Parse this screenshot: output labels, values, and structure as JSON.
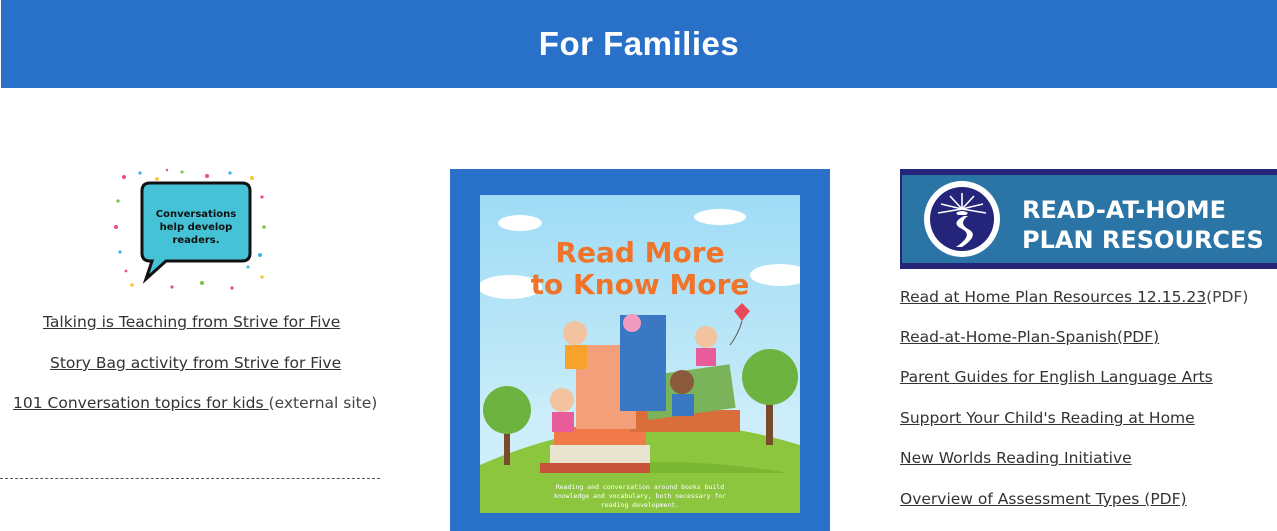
{
  "header": {
    "title": "For Families"
  },
  "left": {
    "image_text": "Conversations help develop readers.",
    "links": [
      {
        "label": "Talking is Teaching from Strive for Five",
        "suffix": ""
      },
      {
        "label": "Story Bag activity from Strive for Five",
        "suffix": ""
      },
      {
        "label": "101 Conversation topics for kids ",
        "suffix": "(external site)"
      }
    ]
  },
  "poster": {
    "title_line1": "Read More",
    "title_line2": "to Know More",
    "caption": "Reading and conversation around books build knowledge and vocabulary, both necessary for reading development."
  },
  "right": {
    "banner_line1": "READ-AT-HOME",
    "banner_line2": "PLAN RESOURCES",
    "links": [
      {
        "label": "Read at Home Plan Resources 12.15.23",
        "suffix": "(PDF)"
      },
      {
        "label": "Read-at-Home-Plan-Spanish(PDF)",
        "suffix": ""
      },
      {
        "label": "Parent Guides for English Language Arts",
        "suffix": ""
      },
      {
        "label": "Support Your Child's Reading at Home",
        "suffix": ""
      },
      {
        "label": "New Worlds Reading Initiative",
        "suffix": ""
      },
      {
        "label": "Overview of Assessment Types (PDF)",
        "suffix": ""
      }
    ]
  }
}
